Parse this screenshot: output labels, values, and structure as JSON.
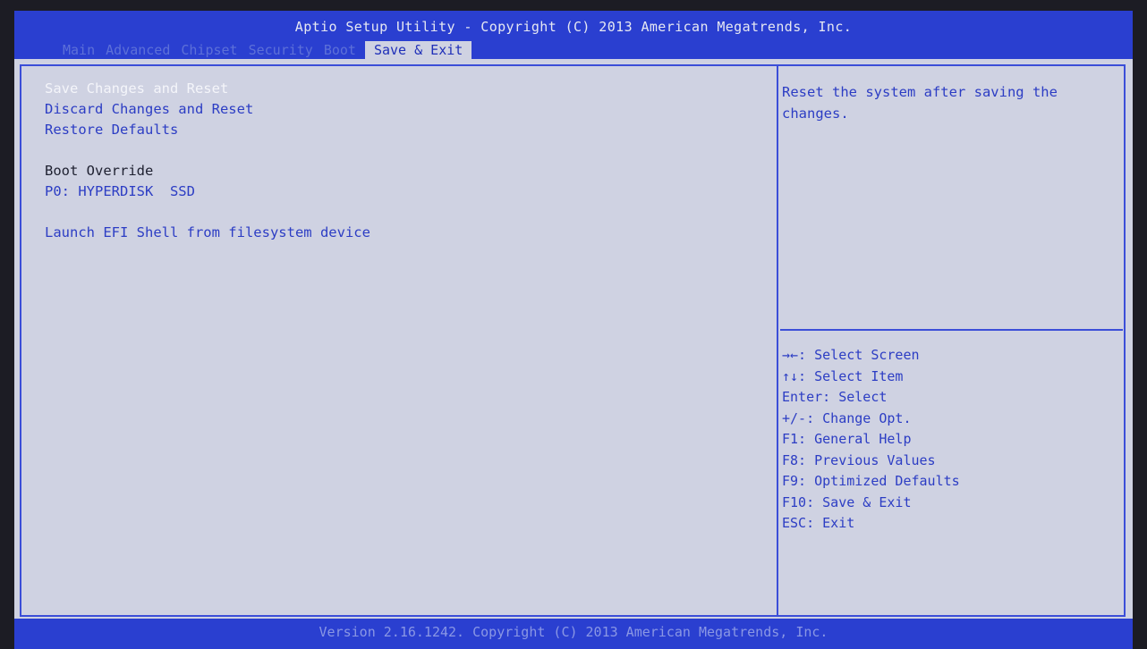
{
  "header": {
    "title": "Aptio Setup Utility - Copyright (C) 2013 American Megatrends, Inc.",
    "tabs": [
      "Main",
      "Advanced",
      "Chipset",
      "Security",
      "Boot",
      "Save & Exit"
    ],
    "active_tab": "Save & Exit"
  },
  "menu": {
    "save_changes_reset": "Save Changes and Reset",
    "discard_changes_reset": "Discard Changes and Reset",
    "restore_defaults": "Restore Defaults",
    "boot_override_heading": "Boot Override",
    "boot_device": "P0: HYPERDISK  SSD",
    "launch_efi_shell": "Launch EFI Shell from filesystem device",
    "selected_item": "Save Changes and Reset"
  },
  "help": {
    "text": "Reset the system after saving the changes."
  },
  "keys": [
    "→←: Select Screen",
    "↑↓: Select Item",
    "Enter: Select",
    "+/-: Change Opt.",
    "F1: General Help",
    "F8: Previous Values",
    "F9: Optimized Defaults",
    "F10: Save & Exit",
    "ESC: Exit"
  ],
  "footer": {
    "version": "Version 2.16.1242. Copyright (C) 2013 American Megatrends, Inc."
  },
  "colors": {
    "header_bg": "#2a3fd0",
    "body_bg": "#cfd2e2",
    "item_text": "#2c3dc4",
    "selected_text": "#f4f5fa"
  }
}
